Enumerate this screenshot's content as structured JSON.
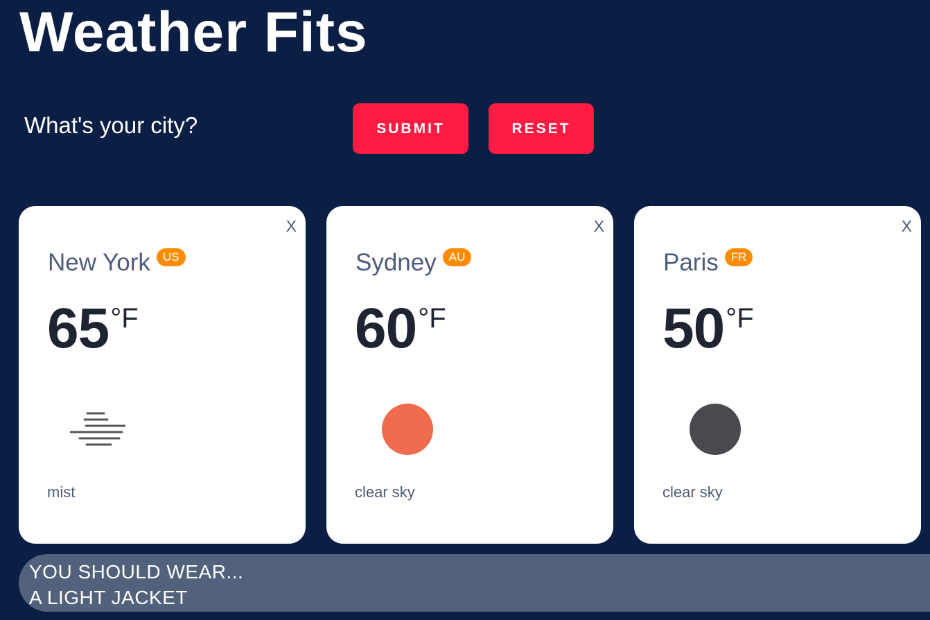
{
  "app": {
    "title": "Weather Fits"
  },
  "search": {
    "prompt": "What's your city?",
    "submit_label": "SUBMIT",
    "reset_label": "RESET"
  },
  "colors": {
    "background": "#0b1f45",
    "button": "#ff1c43",
    "badge": "#ff8c00",
    "sun_clear_day": "#ee6b4d",
    "moon_clear_night": "#4a4a4e",
    "advice_bar": "#52627c"
  },
  "cards": [
    {
      "close_label": "X",
      "city": "New York",
      "country": "US",
      "temp": "65",
      "unit": "°F",
      "icon": "mist-icon",
      "description": "mist"
    },
    {
      "close_label": "X",
      "city": "Sydney",
      "country": "AU",
      "temp": "60",
      "unit": "°F",
      "icon": "clear-sky-day-icon",
      "description": "clear sky"
    },
    {
      "close_label": "X",
      "city": "Paris",
      "country": "FR",
      "temp": "50",
      "unit": "°F",
      "icon": "clear-sky-night-icon",
      "description": "clear sky"
    }
  ],
  "advice": {
    "heading": "YOU SHOULD WEAR...",
    "recommendation": "A LIGHT JACKET"
  }
}
